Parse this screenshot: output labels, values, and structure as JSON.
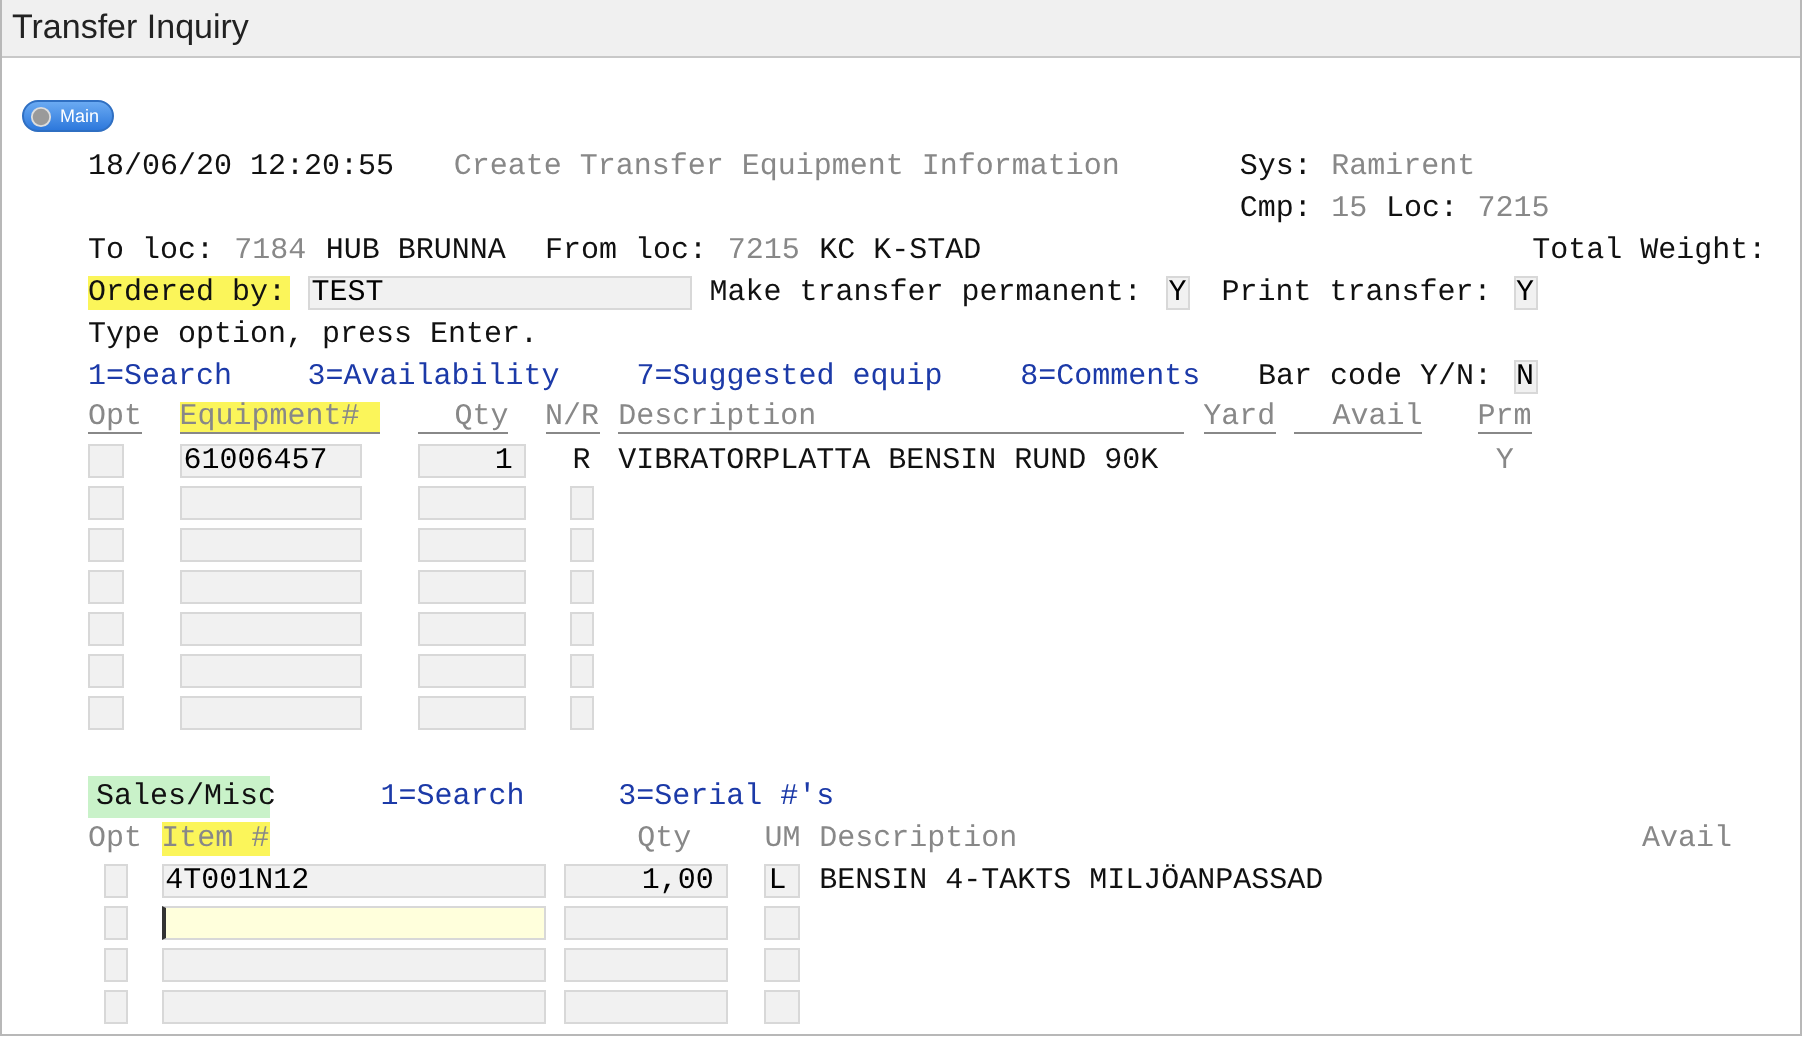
{
  "window": {
    "title": "Transfer Inquiry"
  },
  "main_button": {
    "label": "Main"
  },
  "header": {
    "timestamp": "18/06/20 12:20:55",
    "screen_title": "Create Transfer Equipment Information",
    "sys_label": "Sys:",
    "sys_value": "Ramirent",
    "cmp_label": "Cmp:",
    "cmp_value": "15",
    "loc_label": "Loc:",
    "loc_value": "7215"
  },
  "transfer": {
    "to_loc_label": "To loc:",
    "to_loc_code": "7184",
    "to_loc_name": "HUB BRUNNA",
    "from_loc_label": "From loc:",
    "from_loc_code": "7215",
    "from_loc_name": "KC K-STAD",
    "total_weight_label": "Total Weight:",
    "ordered_by": {
      "label": "Ordered by:",
      "value": "TEST",
      "highlighted": true
    },
    "permanent": {
      "label": "Make transfer permanent:",
      "value": "Y"
    },
    "print": {
      "label": "Print transfer:",
      "value": "Y"
    }
  },
  "instruction": "Type option, press Enter.",
  "options": [
    "1=Search",
    "3=Availability",
    "7=Suggested equip",
    "8=Comments"
  ],
  "barcode": {
    "label": "Bar code Y/N:",
    "value": "N"
  },
  "equipment": {
    "columns": [
      {
        "label": "Opt",
        "highlighted": false
      },
      {
        "label": "Equipment#",
        "highlighted": true
      },
      {
        "label": "Qty",
        "highlighted": false
      },
      {
        "label": "N/R",
        "highlighted": false
      },
      {
        "label": "Description",
        "highlighted": false
      },
      {
        "label": "Yard",
        "highlighted": false
      },
      {
        "label": "Avail",
        "highlighted": false
      },
      {
        "label": "Prm",
        "highlighted": false
      }
    ],
    "rows": [
      {
        "kind": "filled",
        "equipment": "61006457",
        "qty": "1",
        "nr": "R",
        "description": "VIBRATORPLATTA BENSIN RUND 90K",
        "prm": "Y"
      },
      {
        "kind": "blank"
      },
      {
        "kind": "blank"
      },
      {
        "kind": "blank"
      },
      {
        "kind": "blank"
      },
      {
        "kind": "blank"
      },
      {
        "kind": "blank"
      }
    ]
  },
  "sales": {
    "tab": "Sales/Misc",
    "options": [
      "1=Search",
      "3=Serial #'s"
    ],
    "columns": [
      {
        "label": "Opt",
        "highlighted": false
      },
      {
        "label": "Item #",
        "highlighted": true
      },
      {
        "label": "Qty",
        "highlighted": false
      },
      {
        "label": "UM",
        "highlighted": false
      },
      {
        "label": "Description",
        "highlighted": false
      },
      {
        "label": "Avail",
        "highlighted": false
      }
    ],
    "rows": [
      {
        "kind": "filled",
        "focused": false,
        "item": "4T001N12",
        "qty": "1,00",
        "um": "L",
        "description": "BENSIN 4-TAKTS MILJÖANPASSAD"
      },
      {
        "kind": "blank",
        "focused": true
      },
      {
        "kind": "blank",
        "focused": false
      },
      {
        "kind": "blank",
        "focused": false
      }
    ]
  }
}
